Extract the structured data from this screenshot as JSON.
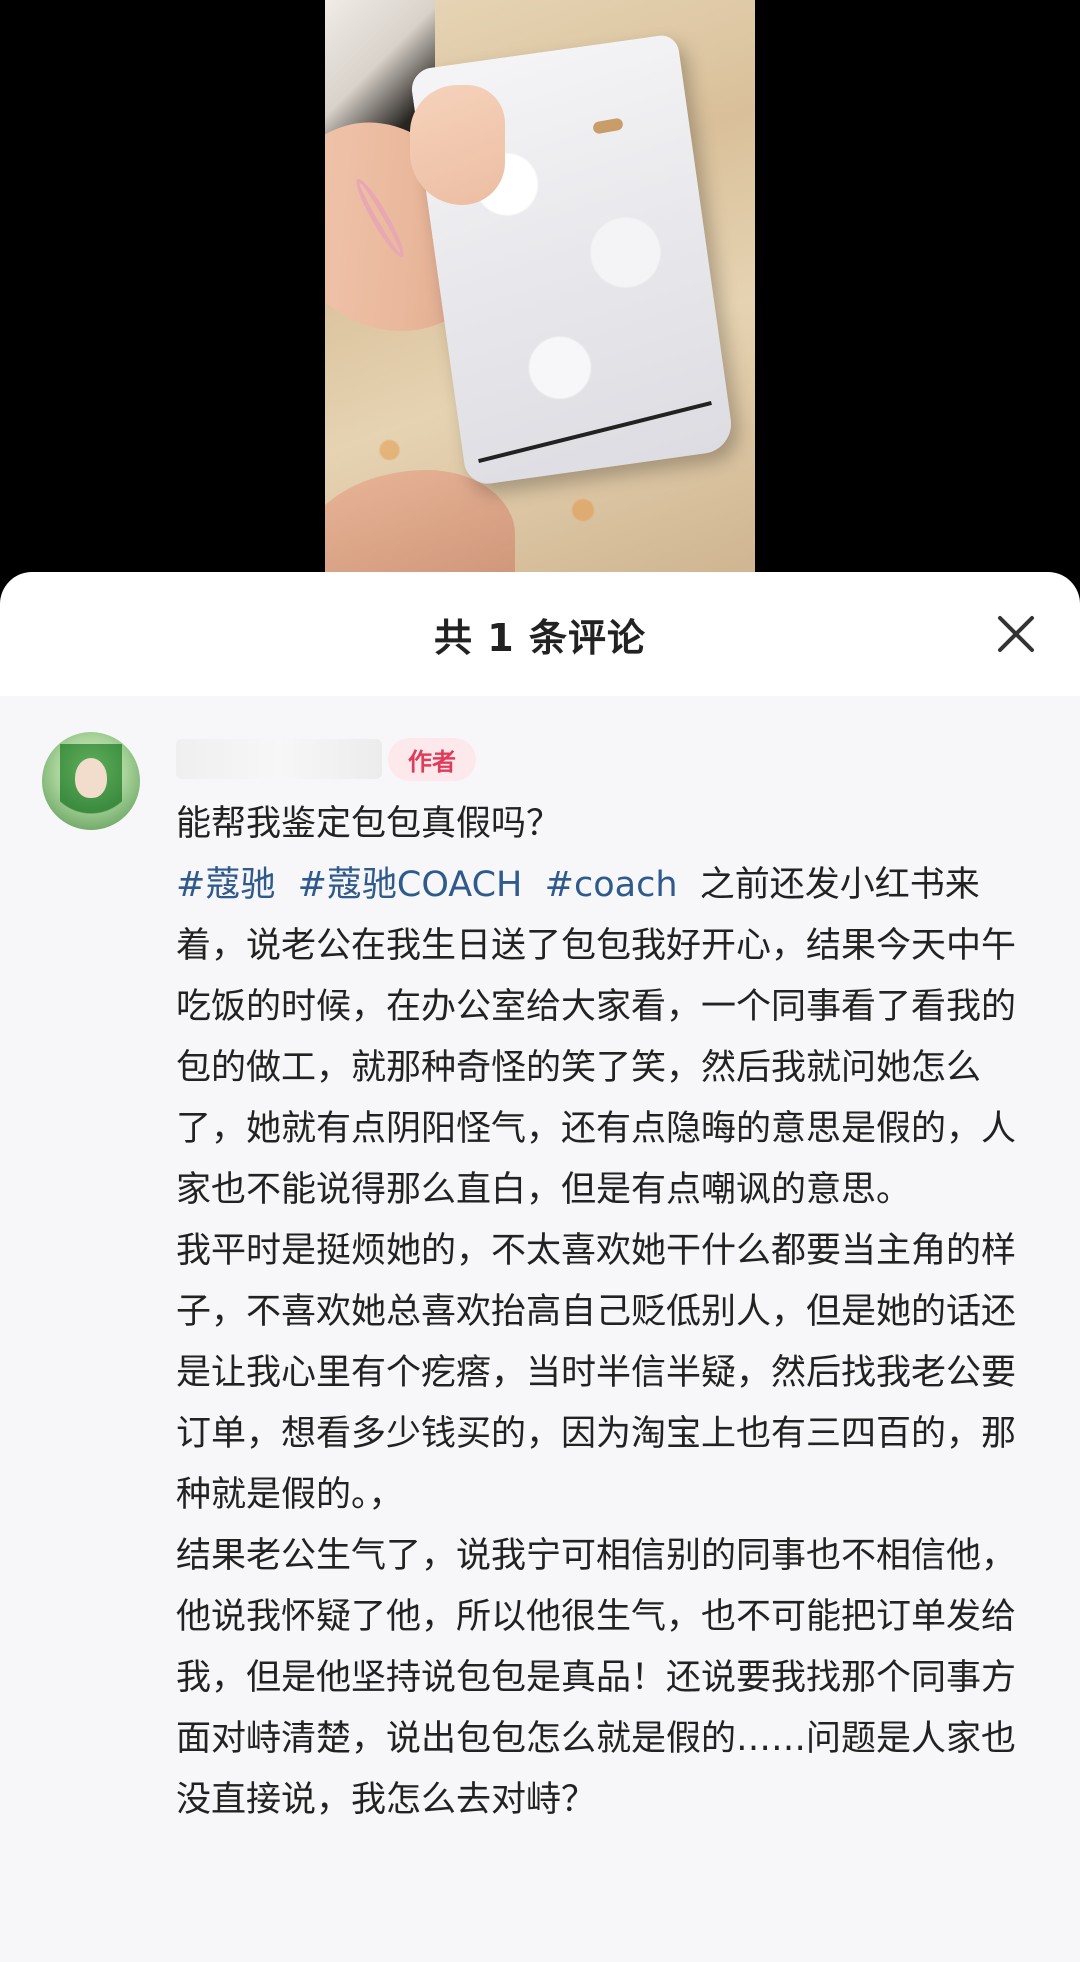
{
  "sheet": {
    "title": "共 1 条评论",
    "close_icon": "close-icon"
  },
  "comment": {
    "author_badge": "作者",
    "question": "能帮我鉴定包包真假吗？",
    "tags": [
      "#蔻驰",
      "#蔻驰COACH",
      "#coach"
    ],
    "paragraph1_after_tags": "之前还发小红书来着，说老公在我生日送了包包我好开心，结果今天中午吃饭的时候，在办公室给大家看，一个同事看了看我的包的做工，就那种奇怪的笑了笑，然后我就问她怎么了，她就有点阴阳怪气，还有点隐晦的意思是假的，人家也不能说得那么直白，但是有点嘲讽的意思。",
    "paragraph2": "我平时是挺烦她的，不太喜欢她干什么都要当主角的样子，不喜欢她总喜欢抬高自己贬低别人，但是她的话还是让我心里有个疙瘩，当时半信半疑，然后找我老公要订单，想看多少钱买的，因为淘宝上也有三四百的，那种就是假的。，",
    "paragraph3": "结果老公生气了，说我宁可相信别的同事也不相信他，他说我怀疑了他，所以他很生气，也不可能把订单发给我，但是他坚持说包包是真品！还说要我找那个同事方面对峙清楚，说出包包怎么就是假的……问题是人家也没直接说，我怎么去对峙？"
  },
  "colors": {
    "tag": "#2e5a8c",
    "badge_text": "#e03c5a",
    "badge_bg": "#fde8ec",
    "sheet_bg": "#f7f7f9"
  }
}
